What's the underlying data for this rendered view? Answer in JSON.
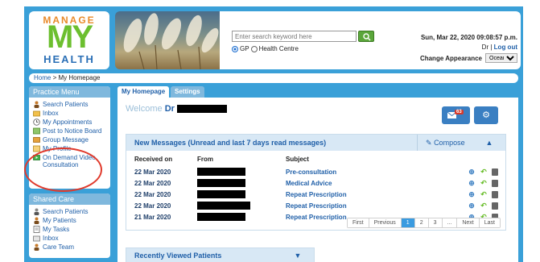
{
  "logo": {
    "line1": "MANAGE",
    "line2": "MY",
    "line3": "HEALTH"
  },
  "search": {
    "placeholder": "Enter search keyword here",
    "option_gp": "GP",
    "option_hc": "Health Centre"
  },
  "header": {
    "datetime": "Sun, Mar 22, 2020 09:08:57 p.m.",
    "user_prefix": "Dr",
    "separator": "|",
    "logout": "Log out",
    "appearance_label": "Change Appearance",
    "appearance_value": "Ocean"
  },
  "breadcrumb": {
    "home": "Home",
    "sep": " > ",
    "current": "My Homepage"
  },
  "practice_menu": {
    "title": "Practice Menu",
    "items": [
      {
        "label": "Search Patients",
        "icon": "patients-icon"
      },
      {
        "label": "Inbox",
        "icon": "inbox-icon"
      },
      {
        "label": "My Appointments",
        "icon": "clock-icon"
      },
      {
        "label": "Post to Notice Board",
        "icon": "notice-icon"
      },
      {
        "label": "Group Message",
        "icon": "group-icon"
      },
      {
        "label": "My Profile",
        "icon": "profile-icon"
      },
      {
        "label": "On Demand Video Consultation",
        "icon": "video-icon"
      }
    ]
  },
  "shared_care": {
    "title": "Shared Care",
    "items": [
      {
        "label": "Search Patients",
        "icon": "search-patients-icon"
      },
      {
        "label": "My Patients",
        "icon": "patients-icon"
      },
      {
        "label": "My Tasks",
        "icon": "tasks-icon"
      },
      {
        "label": "Inbox",
        "icon": "inbox-icon"
      },
      {
        "label": "Care Team",
        "icon": "team-icon"
      }
    ]
  },
  "tabs": [
    {
      "label": "My Homepage"
    },
    {
      "label": "Settings"
    }
  ],
  "welcome": {
    "text": "Welcome",
    "name": "Dr"
  },
  "mail_badge": "63",
  "messages": {
    "title": "New Messages (Unread and last 7 days read messages)",
    "compose": "Compose",
    "columns": {
      "received": "Received on",
      "from": "From",
      "subject": "Subject"
    },
    "rows": [
      {
        "received": "22 Mar 2020",
        "subject": "Pre-consultation"
      },
      {
        "received": "22 Mar 2020",
        "subject": "Medical Advice"
      },
      {
        "received": "22 Mar 2020",
        "subject": "Repeat Prescription"
      },
      {
        "received": "22 Mar 2020",
        "subject": "Repeat Prescription"
      },
      {
        "received": "21 Mar 2020",
        "subject": "Repeat Prescription"
      }
    ],
    "pager": [
      "First",
      "Previous",
      "1",
      "2",
      "3",
      "...",
      "Next",
      "Last"
    ],
    "pager_current": "1"
  },
  "recent": {
    "title": "Recently Viewed Patients"
  },
  "colors": {
    "background": "#3aa0d8",
    "brand_orange": "#e98a2a",
    "brand_green": "#6cbf2f",
    "brand_blue": "#2a6fb6",
    "annotation_red": "#e0392b"
  }
}
